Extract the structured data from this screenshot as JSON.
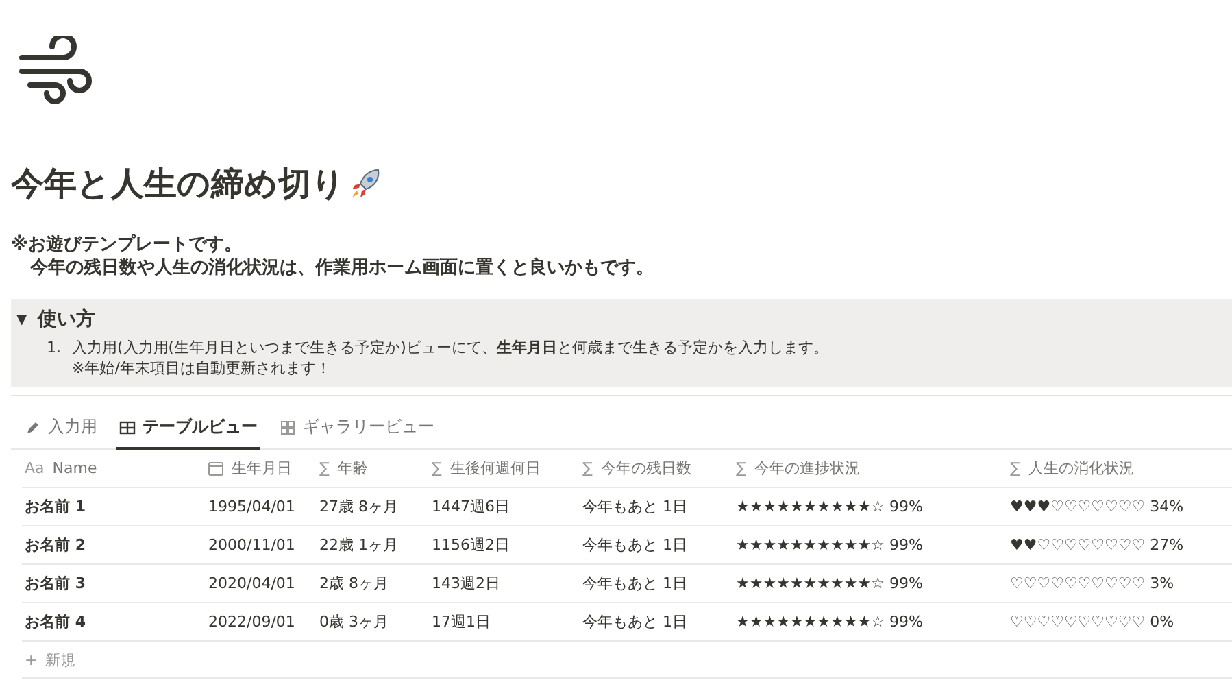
{
  "title": "今年と人生の締め切り",
  "description": [
    "※お遊びテンプレートです。",
    "今年の残日数や人生の消化状況は、作業用ホーム画面に置くと良いかもです。"
  ],
  "toggle": {
    "label": "使い方",
    "expanded": true,
    "toggle_icon": "▼",
    "steps": [
      {
        "number": "1.",
        "text": "入力用(入力用(生年月日といつまで生きる予定か)ビューにて、**生年月日**と何歳まで生きる予定かを入力します。",
        "note": "※年始/年末項目は自動更新されます！"
      }
    ]
  },
  "views": [
    {
      "label": "入力用",
      "kind": "pencil",
      "selected": false
    },
    {
      "label": "テーブルビュー",
      "kind": "table",
      "selected": true
    },
    {
      "label": "ギャラリービュー",
      "kind": "gallery",
      "selected": false
    }
  ],
  "table": {
    "columns": [
      {
        "label": "Name",
        "kind": "text",
        "icon": "Aa"
      },
      {
        "label": "生年月日",
        "kind": "date"
      },
      {
        "label": "年齢",
        "kind": "formula",
        "icon": "∑"
      },
      {
        "label": "生後何週何日",
        "kind": "formula",
        "icon": "∑"
      },
      {
        "label": "今年の残日数",
        "kind": "formula",
        "icon": "∑"
      },
      {
        "label": "今年の進捗状況",
        "kind": "formula",
        "icon": "∑"
      },
      {
        "label": "人生の消化状況",
        "kind": "formula",
        "icon": "∑"
      }
    ],
    "rows": [
      [
        "お名前 1",
        "1995/04/01",
        "27歳 8ヶ月",
        "1447週6日",
        "今年もあと 1日",
        "★★★★★★★★★★☆ 99%",
        "♥♥♥♡♡♡♡♡♡♡ 34%"
      ],
      [
        "お名前 2",
        "2000/11/01",
        "22歳 1ヶ月",
        "1156週2日",
        "今年もあと 1日",
        "★★★★★★★★★★☆ 99%",
        "♥♥♡♡♡♡♡♡♡♡ 27%"
      ],
      [
        "お名前 3",
        "2020/04/01",
        "2歳 8ヶ月",
        "143週2日",
        "今年もあと 1日",
        "★★★★★★★★★★☆ 99%",
        "♡♡♡♡♡♡♡♡♡♡ 3%"
      ],
      [
        "お名前 4",
        "2022/09/01",
        "0歳 3ヶ月",
        "17週1日",
        "今年もあと 1日",
        "★★★★★★★★★★☆ 99%",
        "♡♡♡♡♡♡♡♡♡♡ 0%"
      ]
    ],
    "new_row": {
      "icon": "+",
      "label": "新規"
    }
  }
}
